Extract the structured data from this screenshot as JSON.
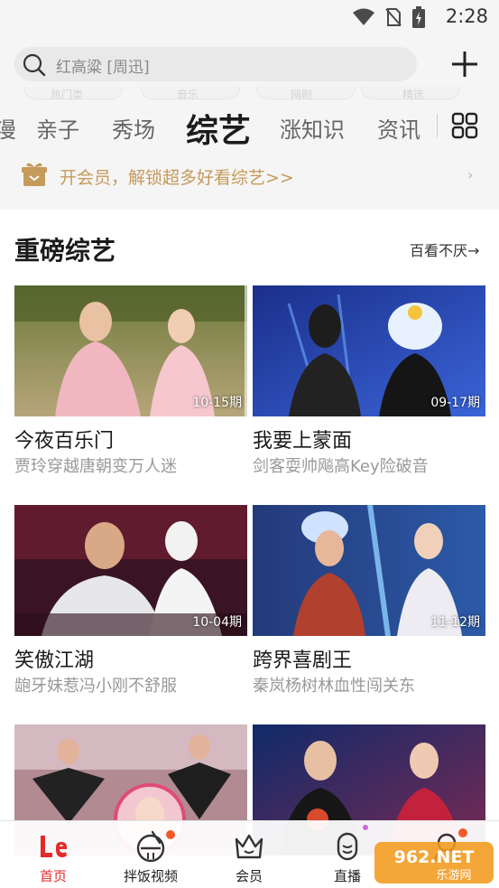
{
  "status_bar": {
    "time": "2:28"
  },
  "search": {
    "placeholder": "红高粱 [周迅]"
  },
  "ghost_tabs": [
    "热门类",
    "音乐",
    "网剧",
    "精选"
  ],
  "tabs": [
    {
      "label": "漫",
      "active": false
    },
    {
      "label": "亲子",
      "active": false
    },
    {
      "label": "秀场",
      "active": false
    },
    {
      "label": "综艺",
      "active": true
    },
    {
      "label": "涨知识",
      "active": false
    },
    {
      "label": "资讯",
      "active": false
    }
  ],
  "vip_banner": {
    "text": "开会员，解锁超多好看综艺>>",
    "chevron": "›"
  },
  "section": {
    "title": "重磅综艺",
    "more": "百看不厌→"
  },
  "cards": [
    {
      "label": "10-15期",
      "title": "今夜百乐门",
      "subtitle": "贾玲穿越唐朝变万人迷"
    },
    {
      "label": "09-17期",
      "title": "我要上蒙面",
      "subtitle": "剑客耍帅飚高Key险破音"
    },
    {
      "label": "10-04期",
      "title": "笑傲江湖",
      "subtitle": "龅牙妹惹冯小刚不舒服"
    },
    {
      "label": "11-12期",
      "title": "跨界喜剧王",
      "subtitle": "秦岚杨树林血性闯关东"
    },
    {
      "label": "",
      "title": "",
      "subtitle": ""
    },
    {
      "label": "",
      "title": "",
      "subtitle": ""
    }
  ],
  "bottom_nav": [
    {
      "label": "首页",
      "icon": "le-logo-icon",
      "active": true
    },
    {
      "label": "拌饭视频",
      "icon": "bowl-icon",
      "active": false
    },
    {
      "label": "会员",
      "icon": "crown-icon",
      "active": false
    },
    {
      "label": "直播",
      "icon": "live-icon",
      "active": false
    },
    {
      "label": "",
      "icon": "profile-icon",
      "active": false
    }
  ],
  "watermark": {
    "text_main": "962.NET",
    "text_sub": "乐游网"
  },
  "colors": {
    "accent_red": "#e42b29",
    "vip_gold": "#c59a5b",
    "badge_orange": "#f05a2a"
  }
}
